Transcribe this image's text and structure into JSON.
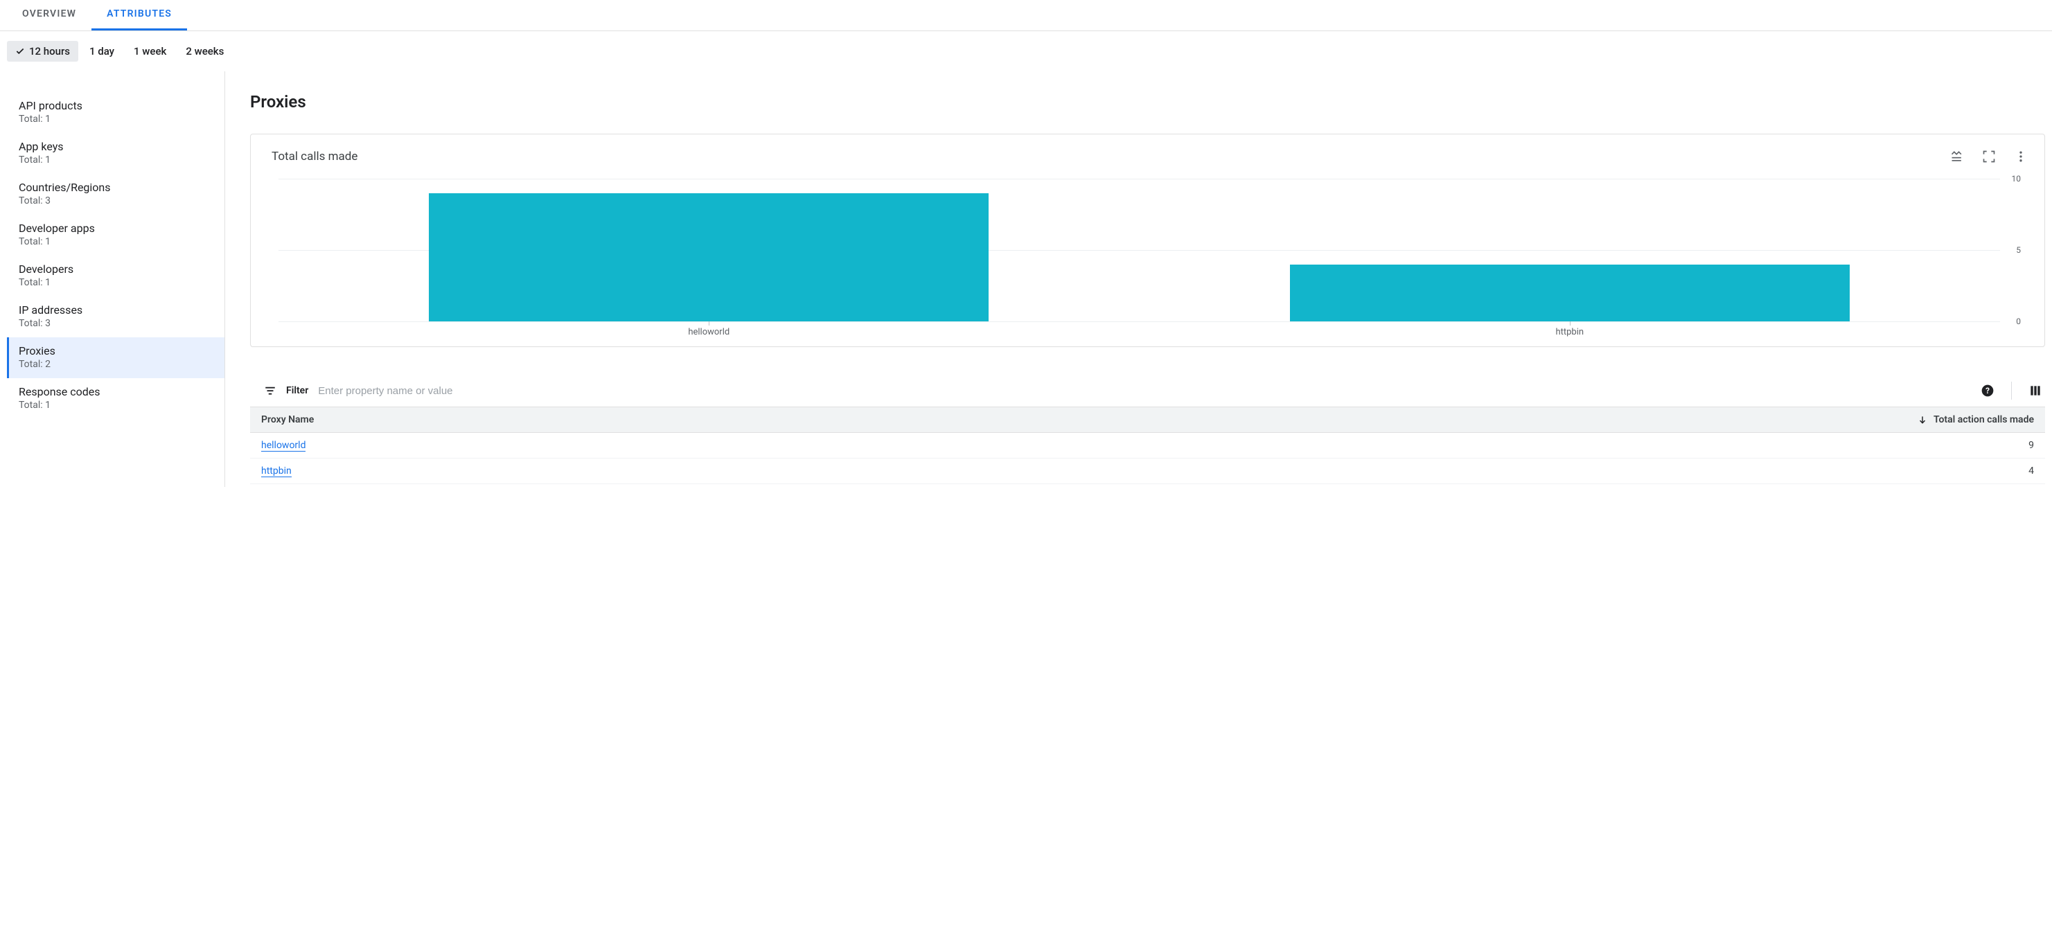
{
  "tabs": {
    "overview": "OVERVIEW",
    "attributes": "ATTRIBUTES"
  },
  "time_ranges": [
    "12 hours",
    "1 day",
    "1 week",
    "2 weeks"
  ],
  "sidebar": [
    {
      "label": "API products",
      "total_text": "Total: 1"
    },
    {
      "label": "App keys",
      "total_text": "Total: 1"
    },
    {
      "label": "Countries/Regions",
      "total_text": "Total: 3"
    },
    {
      "label": "Developer apps",
      "total_text": "Total: 1"
    },
    {
      "label": "Developers",
      "total_text": "Total: 1"
    },
    {
      "label": "IP addresses",
      "total_text": "Total: 3"
    },
    {
      "label": "Proxies",
      "total_text": "Total: 2"
    },
    {
      "label": "Response codes",
      "total_text": "Total: 1"
    }
  ],
  "page_title": "Proxies",
  "card_title": "Total calls made",
  "filter": {
    "label": "Filter",
    "placeholder": "Enter property name or value"
  },
  "table": {
    "col_name": "Proxy Name",
    "col_calls": "Total action calls made"
  },
  "rows": [
    {
      "name": "helloworld",
      "calls": 9
    },
    {
      "name": "httpbin",
      "calls": 4
    }
  ],
  "chart_data": {
    "type": "bar",
    "title": "Total calls made",
    "categories": [
      "helloworld",
      "httpbin"
    ],
    "values": [
      9,
      4
    ],
    "xlabel": "",
    "ylabel": "",
    "ylim": [
      0,
      10
    ],
    "yticks": [
      0,
      5,
      10
    ]
  }
}
